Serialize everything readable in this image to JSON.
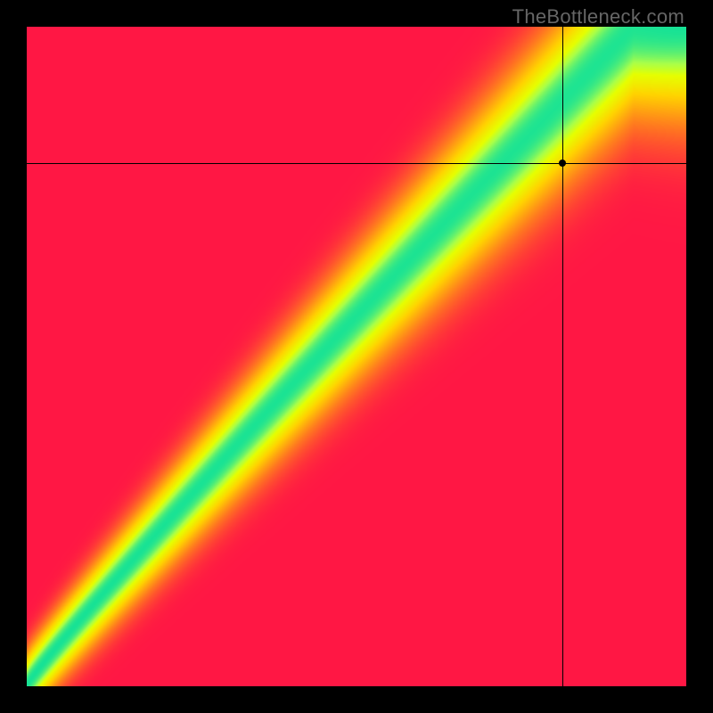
{
  "chart_data": {
    "type": "heatmap",
    "title": "",
    "watermark": "TheBottleneck.com",
    "x_range": [
      0,
      1
    ],
    "y_range": [
      0,
      1
    ],
    "crosshair": {
      "x": 0.812,
      "y": 0.793
    },
    "marker": {
      "x": 0.812,
      "y": 0.793
    },
    "color_stops": [
      {
        "t": 0.0,
        "color": "#ff1744"
      },
      {
        "t": 0.35,
        "color": "#ff7a1f"
      },
      {
        "t": 0.65,
        "color": "#ffd400"
      },
      {
        "t": 0.82,
        "color": "#e6ff00"
      },
      {
        "t": 0.9,
        "color": "#a8ff4a"
      },
      {
        "t": 1.0,
        "color": "#16e296"
      }
    ],
    "ridge": {
      "corner_pull": 0.08,
      "curve_shift": 0.07,
      "curve_gain": 1.3,
      "s_amplitude": 0.06,
      "base_width": 0.055,
      "width_growth": 0.1,
      "falloff": 2.4
    },
    "description": "Heatmap balance chart showing a curved diagonal optimal band (green) from lower-left to upper-right, with suitability decreasing through yellow/orange to red away from the band. Crosshair marker indicates a selected configuration near the upper-right inside the green band."
  }
}
